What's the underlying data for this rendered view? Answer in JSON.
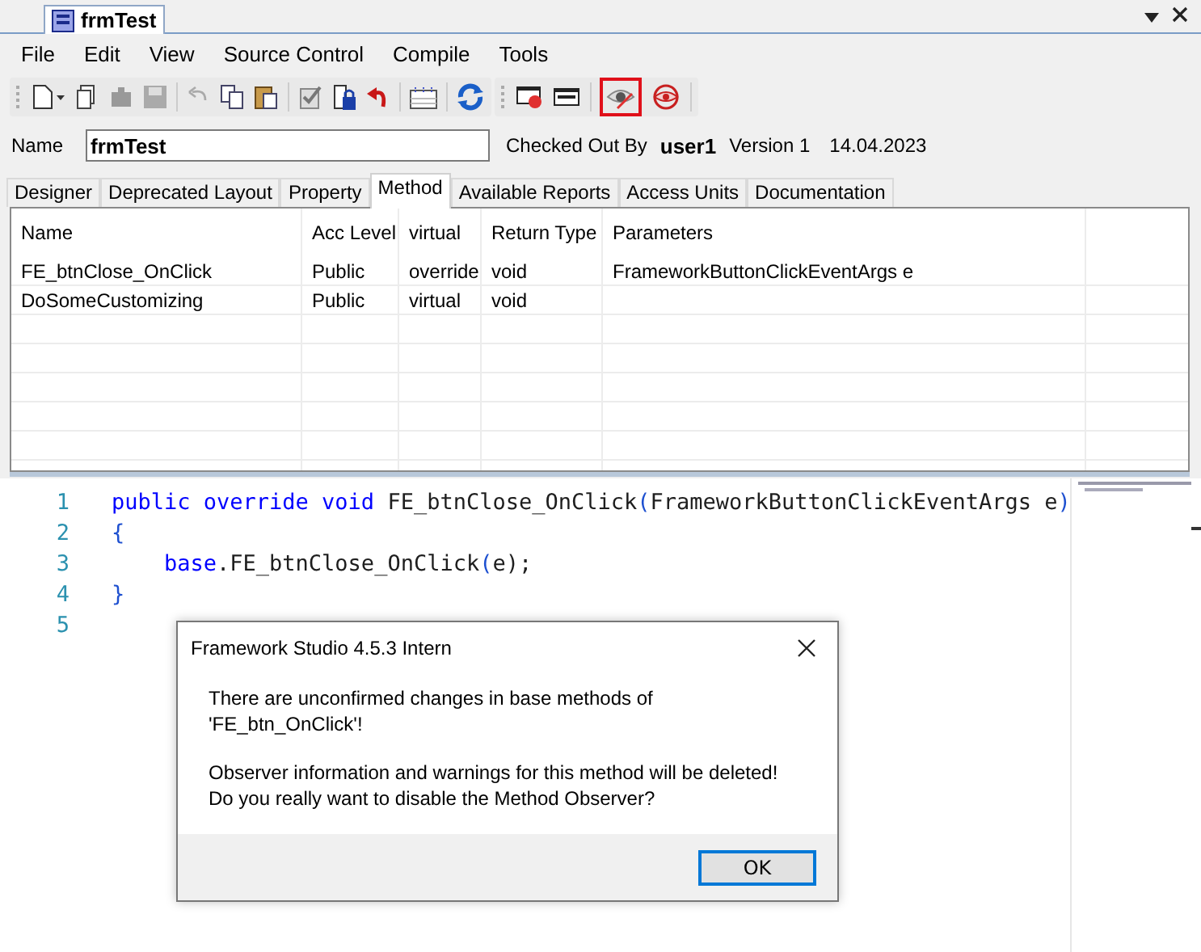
{
  "document_tab": {
    "title": "frmTest"
  },
  "menu": [
    "File",
    "Edit",
    "View",
    "Source Control",
    "Compile",
    "Tools"
  ],
  "toolbar": {
    "observer_button": {
      "highlighted": true
    }
  },
  "header": {
    "name_label": "Name",
    "name_value": "frmTest",
    "checked_out_label": "Checked Out By",
    "checked_out_user": "user1",
    "version": "Version 1",
    "date": "14.04.2023"
  },
  "tabs": [
    {
      "label": "Designer",
      "selected": false
    },
    {
      "label": "Deprecated Layout",
      "selected": false
    },
    {
      "label": "Property",
      "selected": false
    },
    {
      "label": "Method",
      "selected": true
    },
    {
      "label": "Available Reports",
      "selected": false
    },
    {
      "label": "Access Units",
      "selected": false
    },
    {
      "label": "Documentation",
      "selected": false
    }
  ],
  "table": {
    "columns": [
      "Name",
      "Acc Level",
      "virtual",
      "Return Type",
      "Parameters"
    ],
    "rows": [
      [
        "FE_btnClose_OnClick",
        "Public",
        "override",
        "void",
        "FrameworkButtonClickEventArgs e"
      ],
      [
        "DoSomeCustomizing",
        "Public",
        "virtual",
        "void",
        ""
      ]
    ]
  },
  "code": [
    {
      "number": "1",
      "tokens": [
        {
          "text": "public override void",
          "kind": "keyword"
        },
        {
          "text": " FE_btnClose_OnClick",
          "kind": "plain"
        },
        {
          "text": "(",
          "kind": "paren"
        },
        {
          "text": "FrameworkButtonClickEventArgs e",
          "kind": "plain"
        },
        {
          "text": ")",
          "kind": "paren"
        }
      ]
    },
    {
      "number": "2",
      "tokens": [
        {
          "text": "{",
          "kind": "paren"
        }
      ]
    },
    {
      "number": "3",
      "tokens": [
        {
          "text": "    base",
          "kind": "keyword"
        },
        {
          "text": ".FE_btnClose_OnClick",
          "kind": "plain"
        },
        {
          "text": "(",
          "kind": "paren"
        },
        {
          "text": "e",
          "kind": "plain"
        },
        {
          "text": ");",
          "kind": "plain"
        }
      ]
    },
    {
      "number": "4",
      "tokens": [
        {
          "text": "}",
          "kind": "paren"
        }
      ]
    },
    {
      "number": "5"
    }
  ],
  "dialog": {
    "title": "Framework Studio 4.5.3 Intern",
    "message": "There are unconfirmed changes in base methods of 'FE_btn_OnClick'!",
    "detail": "Observer information and warnings for this method will be deleted!\nDo you really want to disable the Method Observer?",
    "button": "OK"
  }
}
